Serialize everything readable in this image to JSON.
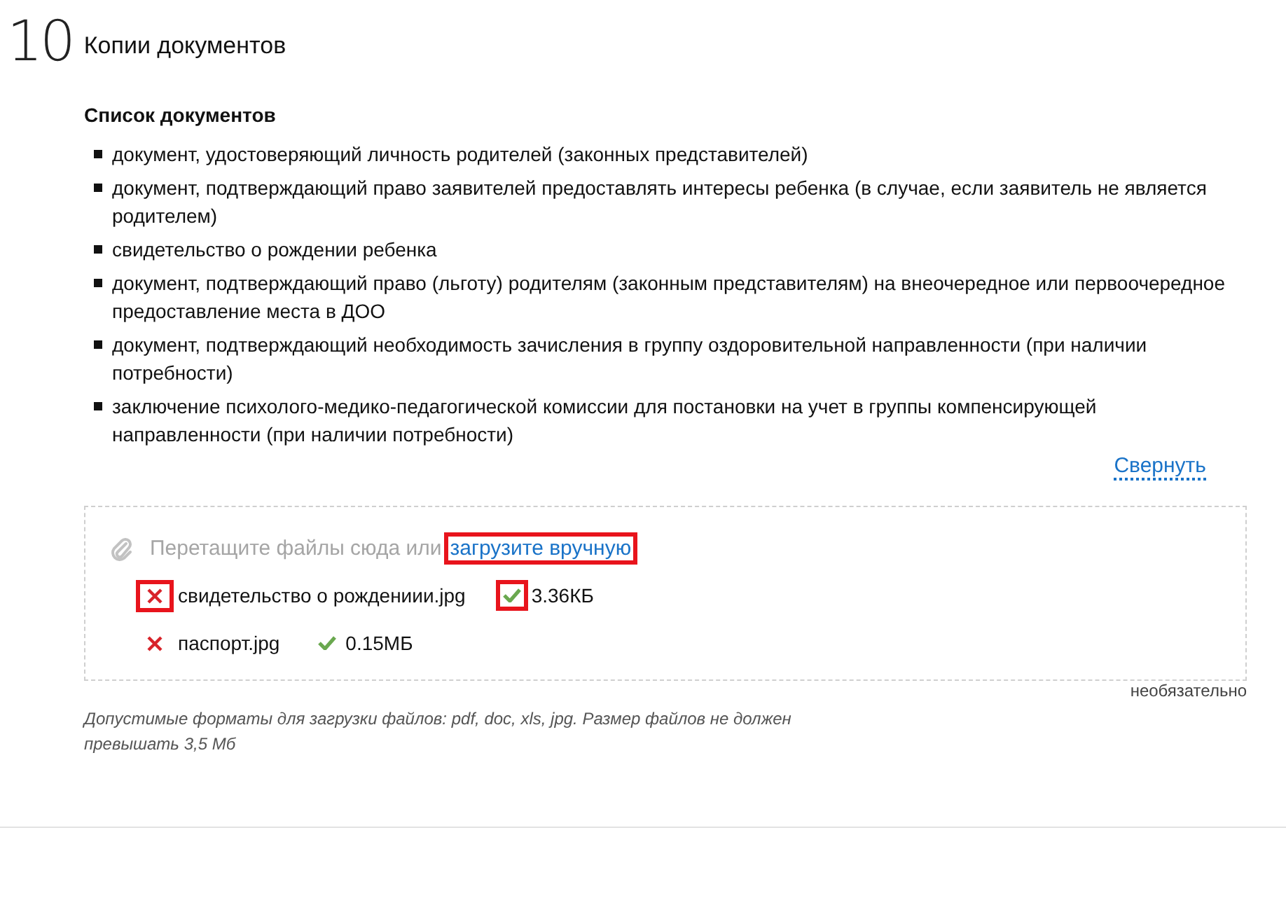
{
  "section": {
    "number": "10",
    "title": "Копии документов"
  },
  "documents": {
    "heading": "Список документов",
    "items": [
      "документ, удостоверяющий личность родителей (законных представителей)",
      "документ, подтверждающий право заявителей предоставлять интересы ребенка (в случае, если заявитель не является родителем)",
      "свидетельство о рождении ребенка",
      "документ, подтверждающий право (льготу) родителям (законным представителям) на внеочередное или первоочередное предоставление места в ДОО",
      "документ, подтверждающий необходимость зачисления в группу оздоровительной направленности (при наличии потребности)",
      "заключение психолого-медико-педагогической комиссии для постановки на учет в группы компенсирующей направленности (при наличии потребности)"
    ],
    "collapse_link": "Свернуть"
  },
  "upload": {
    "prompt": "Перетащите файлы сюда или",
    "link": {
      "label": "загрузите вручную",
      "highlighted": true
    },
    "files": [
      {
        "name": "свидетельство о рождениии.jpg",
        "size": "3.36КБ",
        "remove_highlighted": true,
        "check_highlighted": true
      },
      {
        "name": "паспорт.jpg",
        "size": "0.15МБ",
        "remove_highlighted": false,
        "check_highlighted": false
      }
    ],
    "optional_label": "необязательно"
  },
  "hint": "Допустимые форматы для загрузки файлов: pdf, doc, xls, jpg. Размер файлов не должен превышать 3,5 Мб"
}
